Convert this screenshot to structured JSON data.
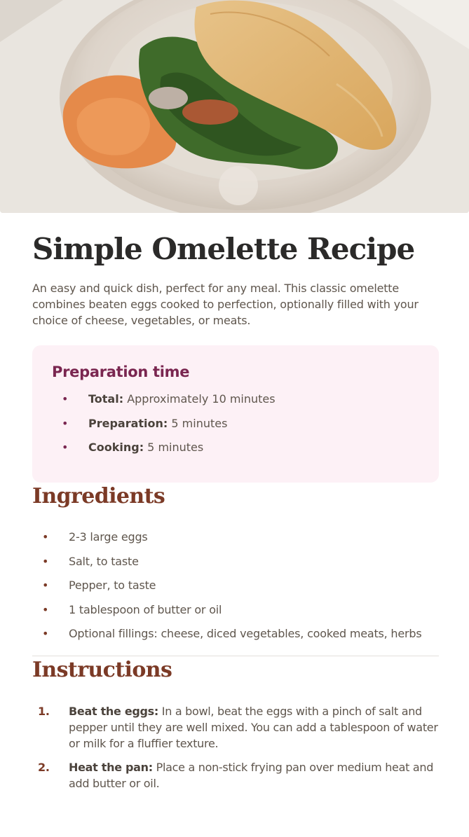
{
  "hero": {
    "image_alt": "omelette-photo"
  },
  "title": "Simple Omelette Recipe",
  "intro": "An easy and quick dish, perfect for any meal. This classic omelette combines beaten eggs cooked to perfection, optionally filled with your choice of cheese, vegetables, or meats.",
  "preparation": {
    "heading": "Preparation time",
    "items": [
      {
        "label": "Total:",
        "text": " Approximately 10 minutes"
      },
      {
        "label": "Preparation:",
        "text": " 5 minutes"
      },
      {
        "label": "Cooking:",
        "text": " 5 minutes"
      }
    ]
  },
  "ingredients": {
    "heading": "Ingredients",
    "items": [
      "2-3 large eggs",
      "Salt, to taste",
      "Pepper, to taste",
      "1 tablespoon of butter or oil",
      "Optional fillings: cheese, diced vegetables, cooked meats, herbs"
    ]
  },
  "instructions": {
    "heading": "Instructions",
    "steps": [
      {
        "num": "1.",
        "label": "Beat the eggs:",
        "text": " In a bowl, beat the eggs with a pinch of salt and pepper until they are well mixed. You can add a tablespoon of water or milk for a fluffier texture."
      },
      {
        "num": "2.",
        "label": "Heat the pan:",
        "text": " Place a non-stick frying pan over medium heat and add butter or oil."
      }
    ]
  },
  "bullet_glyph": "•",
  "colors": {
    "title": "#2b2a29",
    "section_heading": "#7b3a26",
    "prep_heading": "#7a2650",
    "prep_background": "#fdf1f6",
    "body_text": "#5f564d"
  }
}
